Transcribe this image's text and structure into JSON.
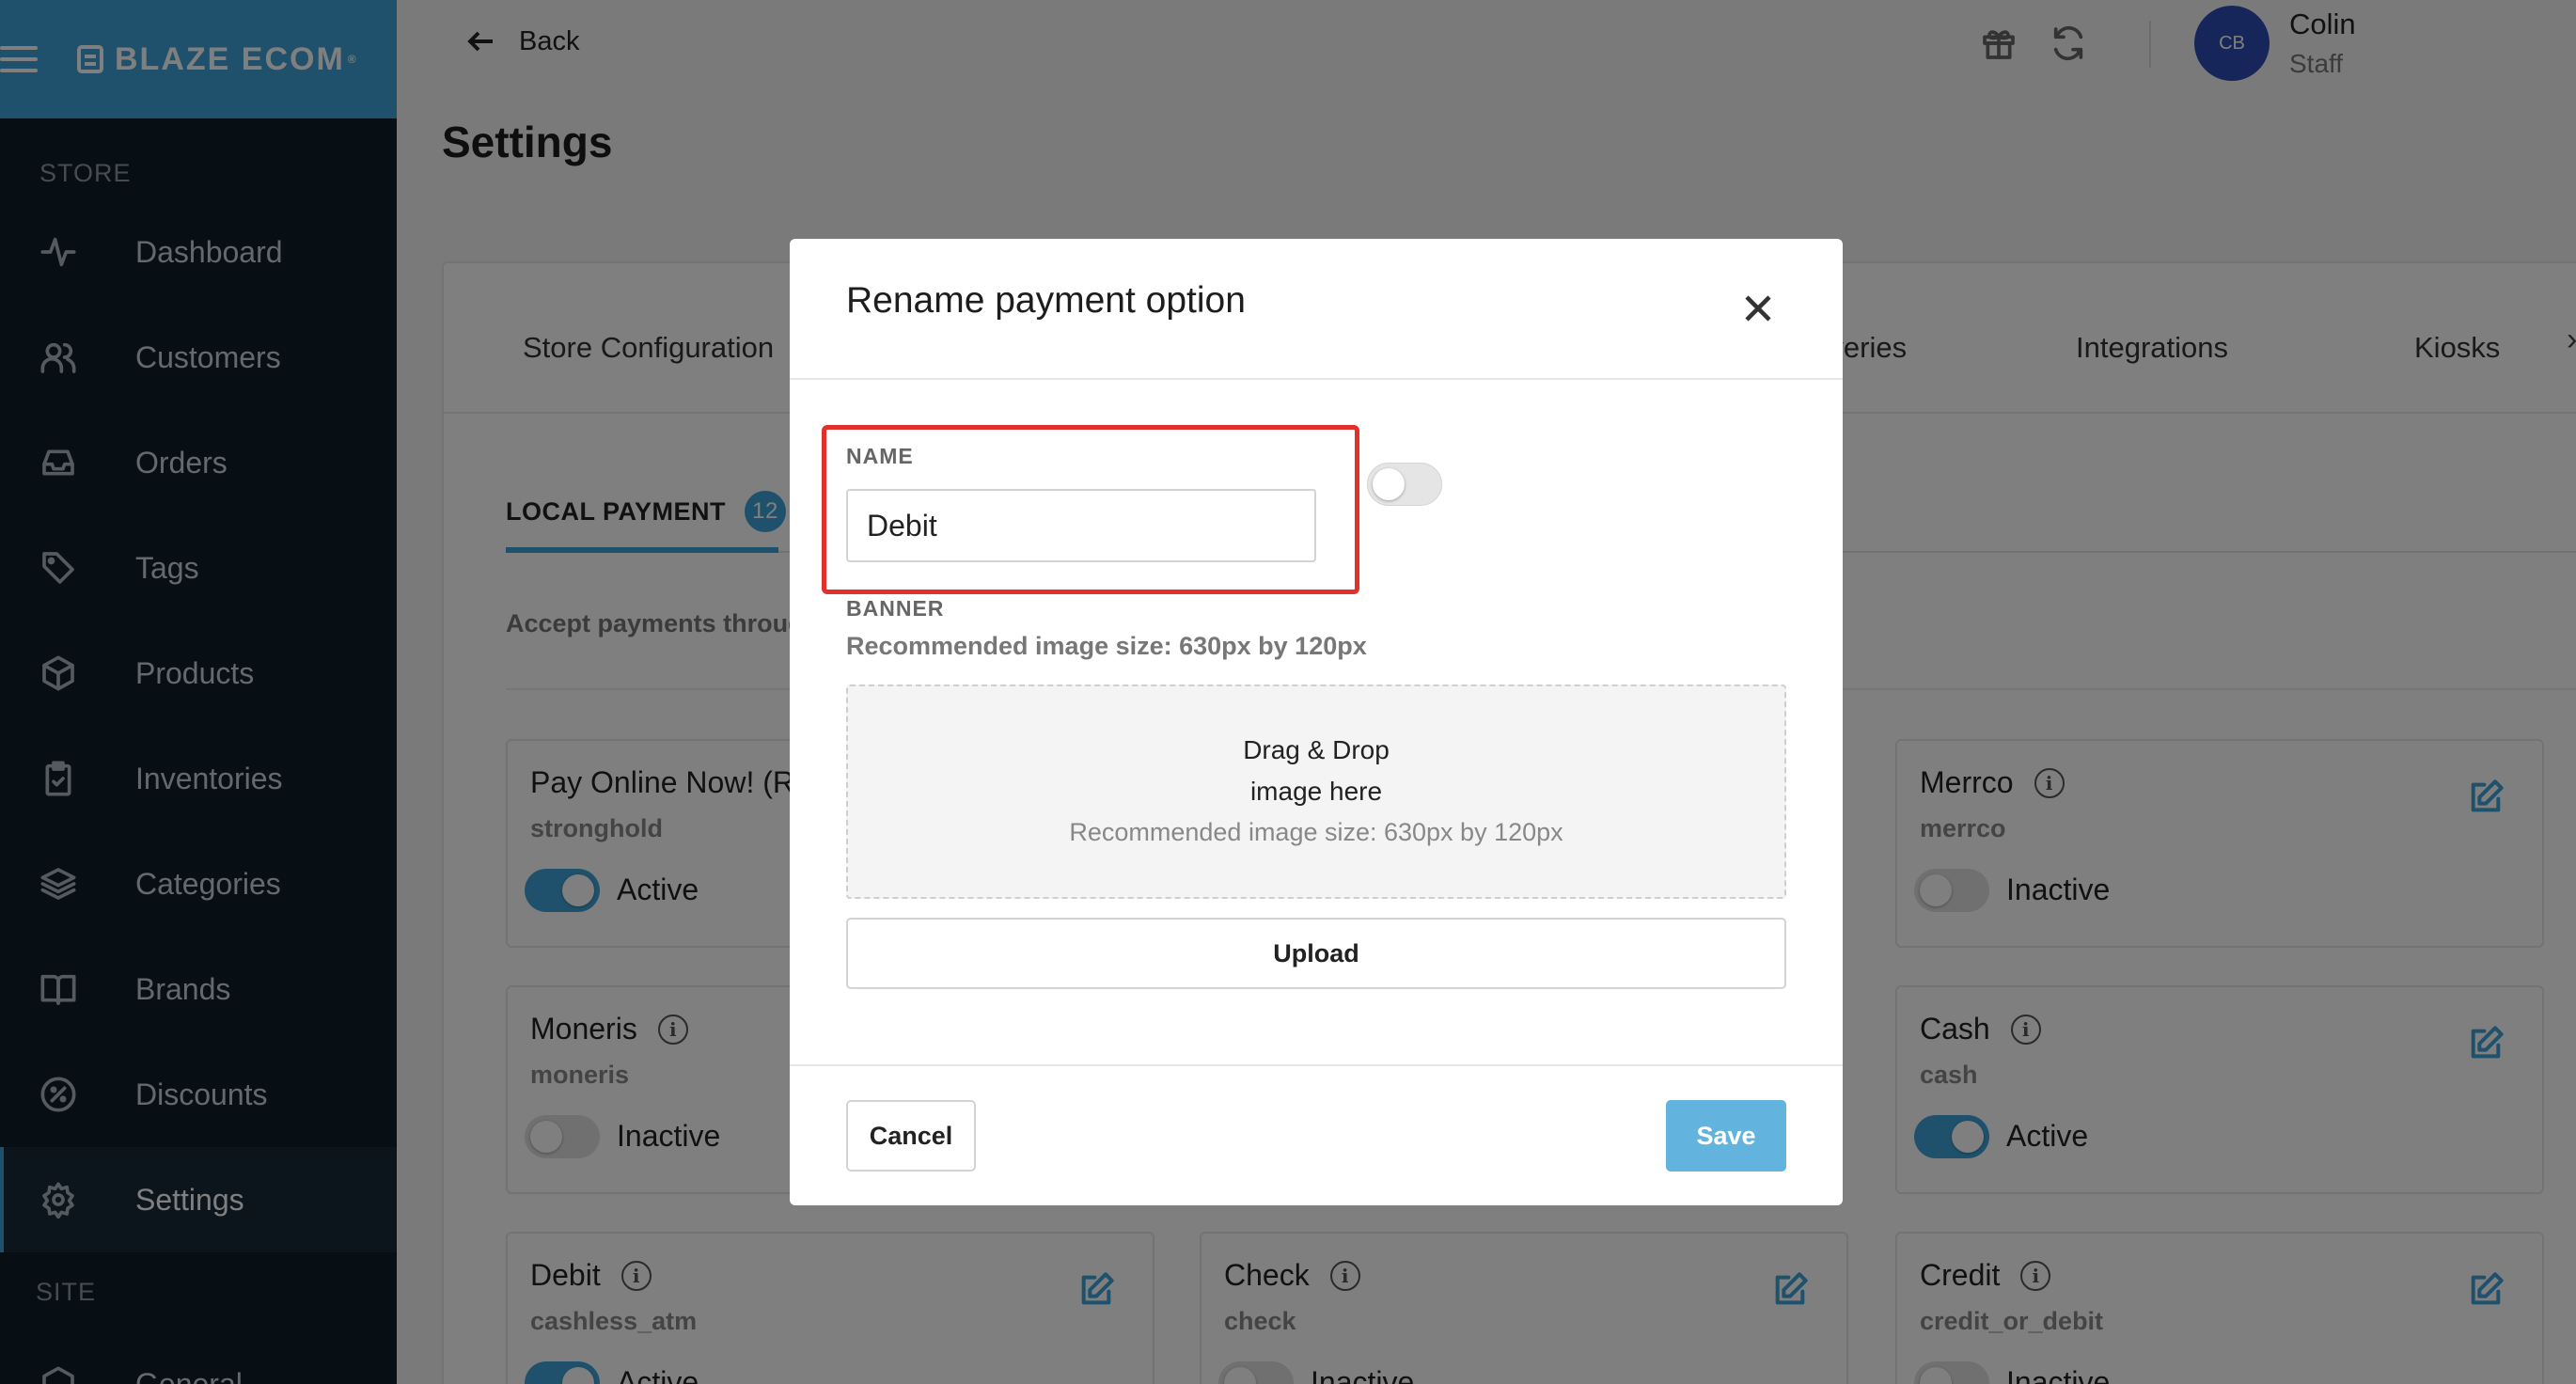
{
  "brand": {
    "name": "BLAZE ECOM",
    "trademark": "®"
  },
  "sidebar": {
    "store_section": "STORE",
    "site_section": "SITE",
    "items": [
      {
        "label": "Dashboard",
        "icon": "activity-icon"
      },
      {
        "label": "Customers",
        "icon": "users-icon"
      },
      {
        "label": "Orders",
        "icon": "inbox-icon"
      },
      {
        "label": "Tags",
        "icon": "tag-icon"
      },
      {
        "label": "Products",
        "icon": "box-icon"
      },
      {
        "label": "Inventories",
        "icon": "clipboard-icon"
      },
      {
        "label": "Categories",
        "icon": "layers-icon"
      },
      {
        "label": "Brands",
        "icon": "book-icon"
      },
      {
        "label": "Discounts",
        "icon": "percent-icon"
      },
      {
        "label": "Settings",
        "icon": "gear-icon",
        "active": true
      }
    ],
    "partial_item": "General"
  },
  "header": {
    "back_label": "Back",
    "user_initials": "CB",
    "user_name": "Colin",
    "user_role": "Staff"
  },
  "page": {
    "title": "Settings"
  },
  "tabs": [
    {
      "label": "Store Configuration"
    },
    {
      "label": "Deliveries"
    },
    {
      "label": "Integrations"
    },
    {
      "label": "Kiosks"
    }
  ],
  "subtab": {
    "label": "LOCAL PAYMENT",
    "count": "12"
  },
  "accept_text": "Accept payments through",
  "payments": [
    {
      "title": "Pay Online Now! (R",
      "code": "stronghold",
      "status": "Active",
      "on": true
    },
    {
      "title": "Merrco",
      "code": "merrco",
      "status": "Inactive",
      "on": false
    },
    {
      "title": "Moneris",
      "code": "moneris",
      "status": "Inactive",
      "on": false
    },
    {
      "title": "Cash",
      "code": "cash",
      "status": "Active",
      "on": true
    },
    {
      "title": "Debit",
      "code": "cashless_atm",
      "status": "Active",
      "on": true
    },
    {
      "title": "Check",
      "code": "check",
      "status": "Inactive",
      "on": false
    },
    {
      "title": "Credit",
      "code": "credit_or_debit",
      "status": "Inactive",
      "on": false
    }
  ],
  "modal": {
    "title": "Rename payment option",
    "name_label": "NAME",
    "name_value": "Debit",
    "banner_label": "BANNER",
    "banner_recommendation": "Recommended image size: 630px by 120px",
    "dropzone_line1": "Drag & Drop",
    "dropzone_line2": "image here",
    "dropzone_line3": "Recommended image size: 630px by 120px",
    "upload_label": "Upload",
    "cancel_label": "Cancel",
    "save_label": "Save"
  },
  "colors": {
    "accent": "#3fa3d8",
    "sidebar_bg": "#0f1e2b",
    "highlight": "#e0312a",
    "save_button": "#62b4df",
    "avatar": "#2c4db4"
  }
}
